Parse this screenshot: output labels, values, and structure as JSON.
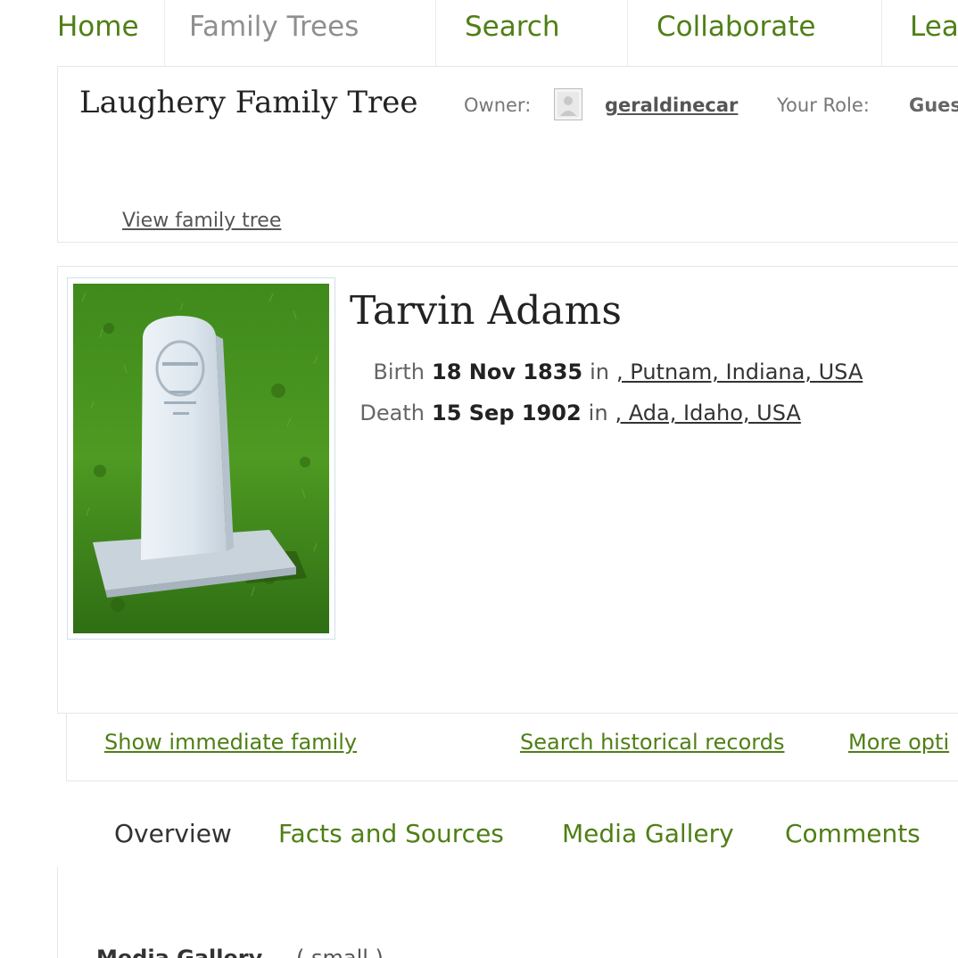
{
  "nav": {
    "items": [
      {
        "label": "Home"
      },
      {
        "label": "Family Trees"
      },
      {
        "label": "Search"
      },
      {
        "label": "Collaborate"
      },
      {
        "label": "Lea"
      }
    ],
    "active": "Family Trees"
  },
  "tree": {
    "title": "Laughery Family Tree",
    "owner_label": "Owner:",
    "owner_name": "geraldinecar",
    "owner_avatar_icon": "user-avatar-icon",
    "role_label": "Your Role:",
    "role_value": "Gues",
    "view_link": "View family tree"
  },
  "person": {
    "name": "Tarvin Adams",
    "photo_icon": "headstone-photo",
    "facts": [
      {
        "label": "Birth",
        "date": "18 Nov 1835",
        "in": "in",
        "place": ", Putnam, Indiana, USA"
      },
      {
        "label": "Death",
        "date": "15 Sep 1902",
        "in": "in",
        "place": ", Ada, Idaho, USA"
      }
    ]
  },
  "actions": {
    "show_family": "Show immediate family",
    "search_records": "Search historical records",
    "more_options": "More opti"
  },
  "tabs": [
    {
      "label": "Overview"
    },
    {
      "label": "Facts and Sources"
    },
    {
      "label": "Media Gallery"
    },
    {
      "label": "Comments"
    }
  ],
  "active_tab": "Overview",
  "content": {
    "media_heading": "Media Gallery",
    "media_count": "( small )"
  },
  "colors": {
    "link_green": "#4f7f15",
    "nav_inactive": "#8f8f8f",
    "border": "#e6e6e6"
  }
}
